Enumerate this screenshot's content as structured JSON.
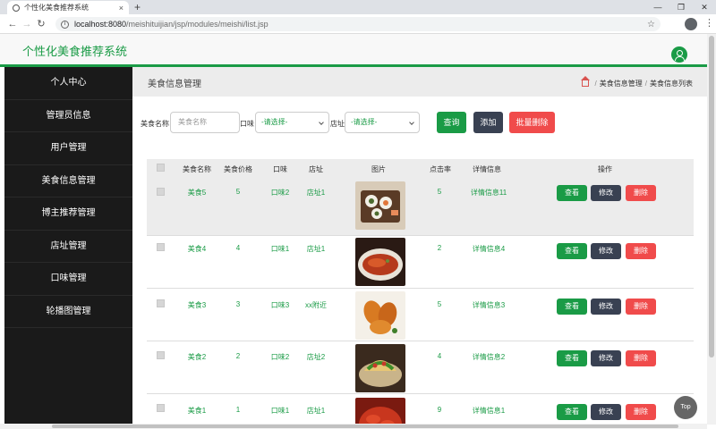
{
  "browser": {
    "tab_title": "个性化美食推荐系统",
    "tab_close": "×",
    "new_tab": "+",
    "url_host": "localhost:8080",
    "url_path": "/meishituijian/jsp/modules/meishi/list.jsp",
    "win_min": "—",
    "win_max": "❐",
    "win_close": "✕"
  },
  "app": {
    "title": "个性化美食推荐系统"
  },
  "sidebar": {
    "items": [
      {
        "label": "个人中心"
      },
      {
        "label": "管理员信息"
      },
      {
        "label": "用户管理"
      },
      {
        "label": "美食信息管理"
      },
      {
        "label": "博主推荐管理"
      },
      {
        "label": "店址管理"
      },
      {
        "label": "口味管理"
      },
      {
        "label": "轮播图管理"
      }
    ]
  },
  "page": {
    "title": "美食信息管理",
    "breadcrumb": [
      "美食信息管理",
      "美食信息列表"
    ]
  },
  "search": {
    "name_label": "美食名称",
    "name_placeholder": "美食名称",
    "taste_label": "口味",
    "taste_value": "-请选择-",
    "shop_label": "店址",
    "shop_value": "-请选择-",
    "query_btn": "查询",
    "add_btn": "添加",
    "batch_delete_btn": "批量删除"
  },
  "table": {
    "headers": [
      "美食名称",
      "美食价格",
      "口味",
      "店址",
      "图片",
      "点击率",
      "详情信息",
      "操作"
    ],
    "action_view": "查看",
    "action_edit": "修改",
    "action_delete": "删除",
    "rows": [
      {
        "name": "美食5",
        "price": "5",
        "taste": "口味2",
        "shop": "店址1",
        "clicks": "5",
        "detail": "详情信息11",
        "img": "sushi"
      },
      {
        "name": "美食4",
        "price": "4",
        "taste": "口味1",
        "shop": "店址1",
        "clicks": "2",
        "detail": "详情信息4",
        "img": "fish"
      },
      {
        "name": "美食3",
        "price": "3",
        "taste": "口味3",
        "shop": "xx附近",
        "clicks": "5",
        "detail": "详情信息3",
        "img": "chicken"
      },
      {
        "name": "美食2",
        "price": "2",
        "taste": "口味2",
        "shop": "店址2",
        "clicks": "4",
        "detail": "详情信息2",
        "img": "taco"
      },
      {
        "name": "美食1",
        "price": "1",
        "taste": "口味1",
        "shop": "店址1",
        "clicks": "9",
        "detail": "详情信息1",
        "img": "crayfish"
      }
    ]
  },
  "top_btn": "Top",
  "colors": {
    "accent": "#1a9b46",
    "sidebar_bg": "#1a1a1a",
    "danger": "#f04b4b",
    "dark_btn": "#394152"
  }
}
